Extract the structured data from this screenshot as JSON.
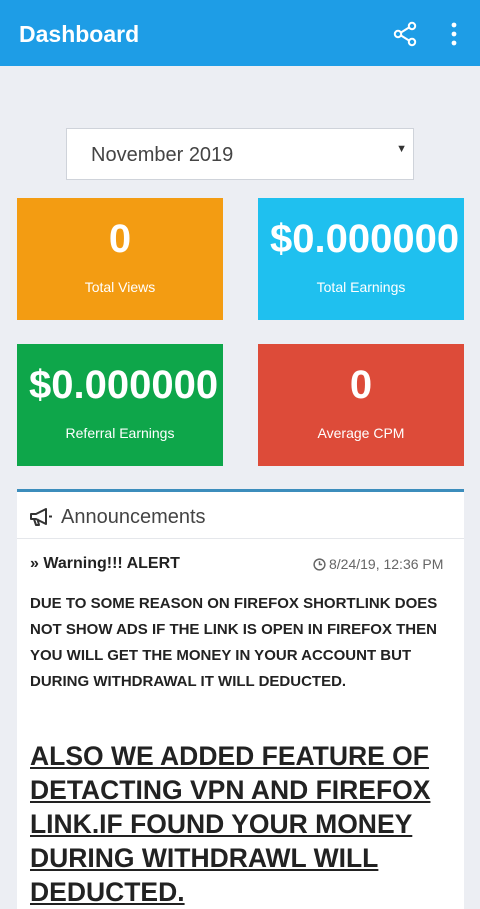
{
  "appbar": {
    "title": "Dashboard",
    "share_icon": "share-icon",
    "more_icon": "more-vert-icon",
    "color": "#1e9de6"
  },
  "month_select": {
    "value": "November 2019"
  },
  "stats": {
    "total_views": {
      "value": "0",
      "label": "Total Views",
      "color": "#f39c12"
    },
    "total_earnings": {
      "value": "$0.000000",
      "label": "Total Earnings",
      "color": "#1fc0ef"
    },
    "referral_earnings": {
      "value": "$0.000000",
      "label": "Referral Earnings",
      "color": "#0ea64a"
    },
    "average_cpm": {
      "value": "0",
      "label": "Average CPM",
      "color": "#dd4b39"
    }
  },
  "announcements": {
    "title": "Announcements",
    "icon": "bullhorn-icon",
    "item": {
      "title": "Warning!!! ALERT",
      "time": "8/24/19, 12:36 PM",
      "message": "DUE TO SOME REASON ON FIREFOX SHORTLINK DOES NOT SHOW ADS IF THE LINK IS OPEN IN FIREFOX THEN YOU WILL GET THE MONEY IN YOUR ACCOUNT BUT DURING WITHDRAWAL IT WILL DEDUCTED.",
      "emphasis": "ALSO WE ADDED FEATURE OF DETACTING VPN AND FIREFOX LINK.IF FOUND YOUR  MONEY DURING WITHDRAWL WILL DEDUCTED."
    }
  }
}
